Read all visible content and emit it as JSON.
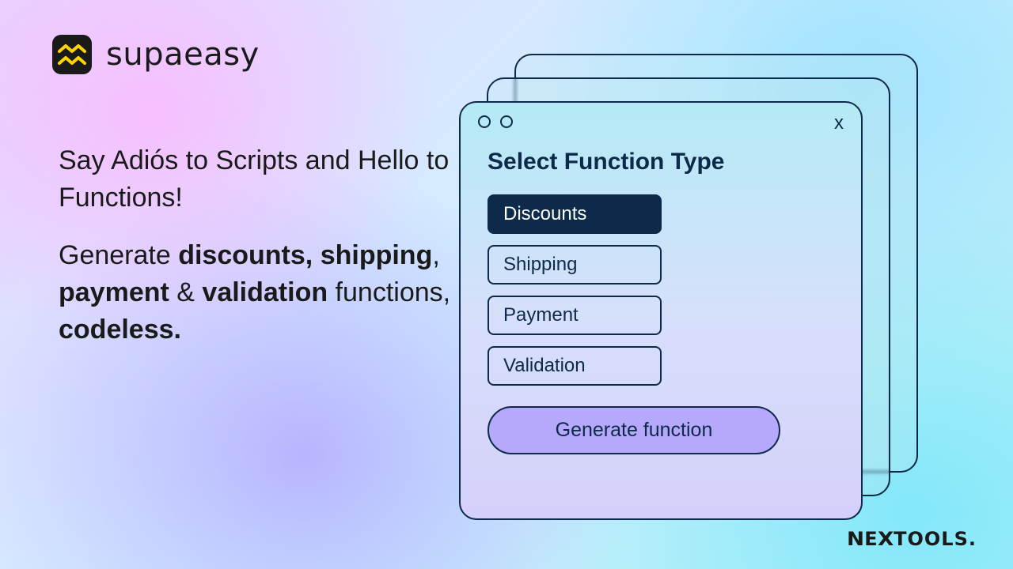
{
  "brand": {
    "name": "supaeasy",
    "footer": "NEXTOOLS.",
    "accent": "#ffd400"
  },
  "hero": {
    "line1": "Say Adiós to Scripts and Hello to Functions!",
    "line2_prefix": "Generate ",
    "line2_b1": "discounts,",
    "line2_b2": " shipping",
    "line2_mid": ", ",
    "line2_b3": "payment",
    "line2_after": " & ",
    "line2_b4": "validation",
    "line2_tail": " functions, ",
    "line2_b5": "codeless."
  },
  "window": {
    "title": "Select Function Type",
    "options": {
      "0": {
        "label": "Discounts",
        "selected": true
      },
      "1": {
        "label": "Shipping",
        "selected": false
      },
      "2": {
        "label": "Payment",
        "selected": false
      },
      "3": {
        "label": "Validation",
        "selected": false
      }
    },
    "cta": "Generate function",
    "close_glyph": "x"
  }
}
